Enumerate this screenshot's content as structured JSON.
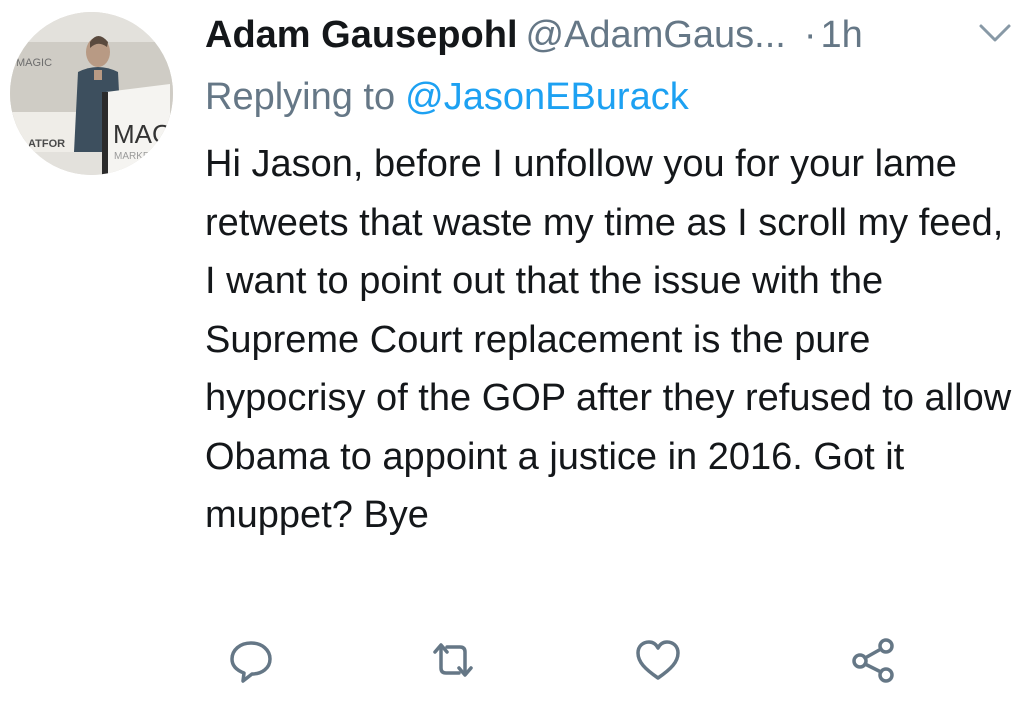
{
  "tweet": {
    "author_name": "Adam Gausepohl",
    "author_handle": "@AdamGaus...",
    "separator": "·",
    "time": "1h",
    "replying_prefix": "Replying to",
    "replying_handle": "@JasonEBurack",
    "text": "Hi Jason, before I unfollow you for your lame retweets that waste my time as I scroll my feed, I want to point out that the issue with the Supreme Court replacement is the pure hypocrisy of the GOP after they refused to allow Obama to appoint a justice in 2016. Got it muppet? Bye"
  },
  "avatar": {
    "sign_top": "MAGIC",
    "sign_left": "PLATFOR",
    "podium_text": "MAG",
    "podium_subtext": "MARKE"
  },
  "actions": {
    "icons": [
      "reply-icon",
      "retweet-icon",
      "like-icon",
      "share-icon"
    ]
  },
  "colors": {
    "text": "#14171a",
    "muted": "#657786",
    "link": "#1da1f2"
  }
}
